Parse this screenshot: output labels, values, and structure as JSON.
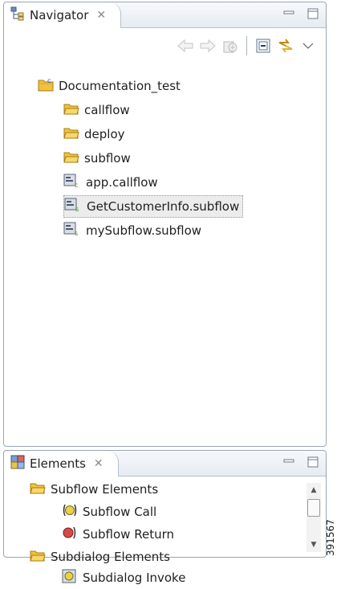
{
  "navigator": {
    "title": "Navigator",
    "close_glyph": "✕",
    "icon": "navigator-icon",
    "toolbar": [
      "back-arrow-icon",
      "forward-arrow-icon",
      "home-icon",
      "collapse-all-icon",
      "link-with-editor-icon",
      "view-menu-icon"
    ],
    "tree": [
      {
        "label": "Documentation_test",
        "icon": "project-folder-icon",
        "level": 0
      },
      {
        "label": "callflow",
        "icon": "folder-icon",
        "level": 1
      },
      {
        "label": "deploy",
        "icon": "folder-icon",
        "level": 1
      },
      {
        "label": "subflow",
        "icon": "folder-icon",
        "level": 1
      },
      {
        "label": "app.callflow",
        "icon": "callflow-file-icon",
        "level": 1
      },
      {
        "label": "GetCustomerInfo.subflow",
        "icon": "subflow-file-icon",
        "level": 1,
        "selected": true
      },
      {
        "label": "mySubflow.subflow",
        "icon": "subflow-file-icon",
        "level": 1
      }
    ]
  },
  "elements": {
    "title": "Elements",
    "close_glyph": "✕",
    "icon": "elements-icon",
    "tree": [
      {
        "label": "Subflow Elements",
        "icon": "folder-icon",
        "level": 0
      },
      {
        "label": "Subflow Call",
        "icon": "subflow-call-icon",
        "level": 1
      },
      {
        "label": "Subflow Return",
        "icon": "subflow-return-icon",
        "level": 1
      },
      {
        "label": "Subdialog Elements",
        "icon": "folder-icon",
        "level": 0
      },
      {
        "label": "Subdialog Invoke",
        "icon": "subdialog-invoke-icon",
        "level": 1
      }
    ]
  },
  "figure_id": "391567",
  "colors": {
    "folder": "#f2c23e",
    "panel_border": "#9aa7b8",
    "selection": "#ececec"
  }
}
